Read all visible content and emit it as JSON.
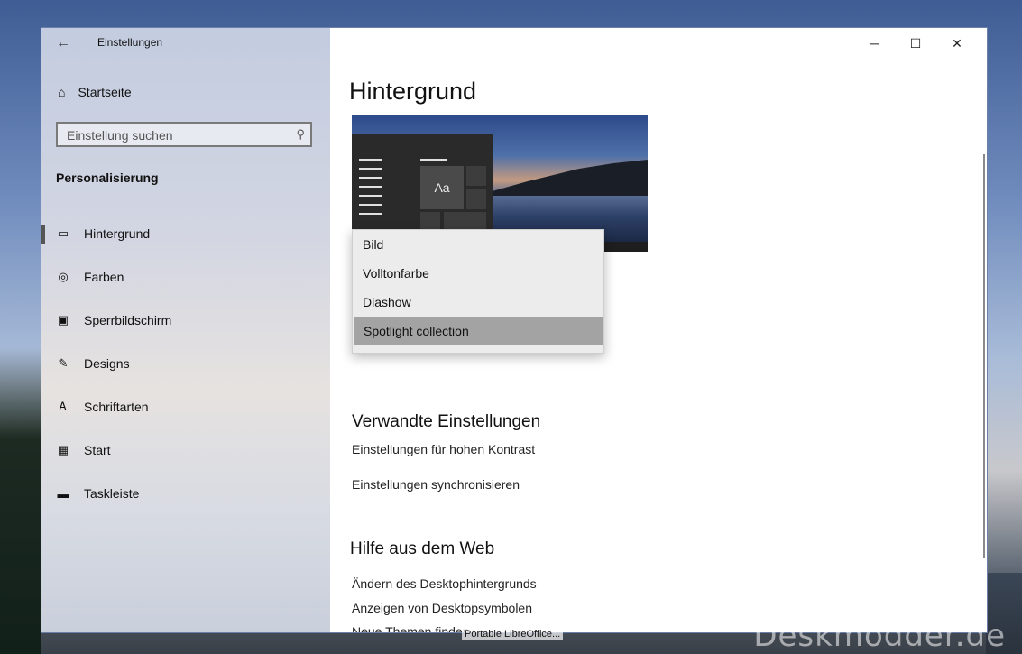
{
  "window": {
    "title": "Einstellungen",
    "back_icon": "arrow-left-icon",
    "controls": {
      "minimize": "─",
      "maximize": "☐",
      "close": "✕"
    }
  },
  "sidebar": {
    "home_label": "Startseite",
    "search_placeholder": "Einstellung suchen",
    "section_title": "Personalisierung",
    "items": [
      {
        "label": "Hintergrund",
        "icon": "picture-icon",
        "active": true
      },
      {
        "label": "Farben",
        "icon": "palette-icon"
      },
      {
        "label": "Sperrbildschirm",
        "icon": "lock-screen-icon"
      },
      {
        "label": "Designs",
        "icon": "brush-icon"
      },
      {
        "label": "Schriftarten",
        "icon": "font-icon"
      },
      {
        "label": "Start",
        "icon": "start-menu-icon"
      },
      {
        "label": "Taskleiste",
        "icon": "taskbar-icon"
      }
    ]
  },
  "main": {
    "title": "Hintergrund",
    "preview_tile_text": "Aa",
    "dropdown_options": [
      "Bild",
      "Volltonfarbe",
      "Diashow",
      "Spotlight collection"
    ],
    "dropdown_selected": "Spotlight collection",
    "related_title": "Verwandte Einstellungen",
    "related_links": [
      "Einstellungen für hohen Kontrast",
      "Einstellungen synchronisieren"
    ],
    "help_title": "Hilfe aus dem Web",
    "help_links": [
      "Ändern des Desktophintergrunds",
      "Anzeigen von Desktopsymbolen",
      "Neue Themen finden"
    ]
  },
  "desktop": {
    "taskbar_tooltip": "Portable LibreOffice...",
    "watermark": "Deskmodder.de"
  }
}
